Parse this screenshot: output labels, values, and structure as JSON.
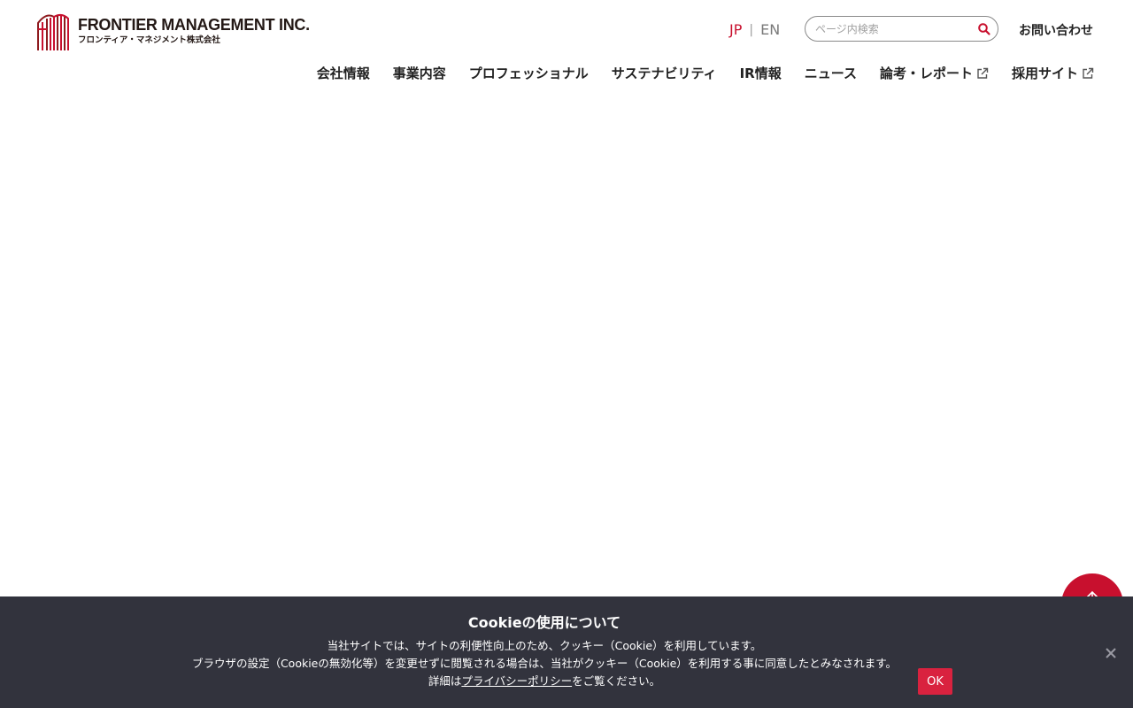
{
  "header": {
    "logo": {
      "name_en": "FRONTIER MANAGEMENT INC.",
      "name_ja": "フロンティア・マネジメント株式会社",
      "brand_color": "#c8102e"
    },
    "language": {
      "jp": "JP",
      "separator": "|",
      "en": "EN",
      "active": "JP"
    },
    "search": {
      "placeholder": "ページ内検索",
      "value": "",
      "icon": "search-icon"
    },
    "contact_label": "お問い合わせ",
    "nav": [
      {
        "label": "会社情報",
        "external": false
      },
      {
        "label": "事業内容",
        "external": false
      },
      {
        "label": "プロフェッショナル",
        "external": false
      },
      {
        "label": "サステナビリティ",
        "external": false
      },
      {
        "label": "IR情報",
        "external": false
      },
      {
        "label": "ニュース",
        "external": false
      },
      {
        "label": "論考・レポート",
        "external": true
      },
      {
        "label": "採用サイト",
        "external": true
      }
    ]
  },
  "pagetop": {
    "icon": "arrow-up-icon",
    "color": "#c8102e"
  },
  "cookie": {
    "title": "Cookieの使用について",
    "line1": "当社サイトでは、サイトの利便性向上のため、クッキー（Cookie）を利用しています。",
    "line2": "ブラウザの設定（Cookieの無効化等）を変更せずに閲覧される場合は、当社がクッキー（Cookie）を利用する事に同意したとみなされます。",
    "line3_prefix": "詳細は",
    "policy_link": "プライバシーポリシー",
    "line3_suffix": "をご覧ください。",
    "ok_label": "OK",
    "close_icon": "close-icon",
    "background": "#32333d",
    "button_color": "#d9223f"
  }
}
